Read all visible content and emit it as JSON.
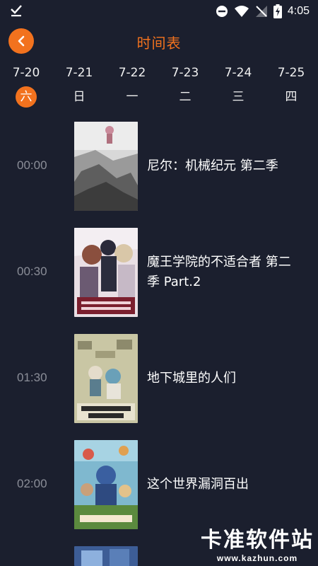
{
  "status_bar": {
    "time": "4:05",
    "icons": [
      "download-done-icon",
      "do-not-disturb-icon",
      "wifi-icon",
      "no-signal-icon",
      "battery-charging-icon"
    ]
  },
  "header": {
    "title": "时间表",
    "back_icon": "chevron-left-icon",
    "accent_color": "#f2721e"
  },
  "days": [
    {
      "date": "7-20",
      "weekday": "六",
      "selected": true
    },
    {
      "date": "7-21",
      "weekday": "日",
      "selected": false
    },
    {
      "date": "7-22",
      "weekday": "一",
      "selected": false
    },
    {
      "date": "7-23",
      "weekday": "二",
      "selected": false
    },
    {
      "date": "7-24",
      "weekday": "三",
      "selected": false
    },
    {
      "date": "7-25",
      "weekday": "四",
      "selected": false
    }
  ],
  "schedule": [
    {
      "time": "00:00",
      "title": "尼尔：机械纪元 第二季"
    },
    {
      "time": "00:30",
      "title": "魔王学院的不适合者 第二季 Part.2"
    },
    {
      "time": "01:30",
      "title": "地下城里的人们"
    },
    {
      "time": "02:00",
      "title": "这个世界漏洞百出"
    }
  ],
  "watermark": {
    "main": "卡准软件站",
    "sub": "www.kazhun.com"
  },
  "colors": {
    "background": "#1b1f2e",
    "accent": "#f2721e",
    "time_text": "#8b8e98"
  }
}
